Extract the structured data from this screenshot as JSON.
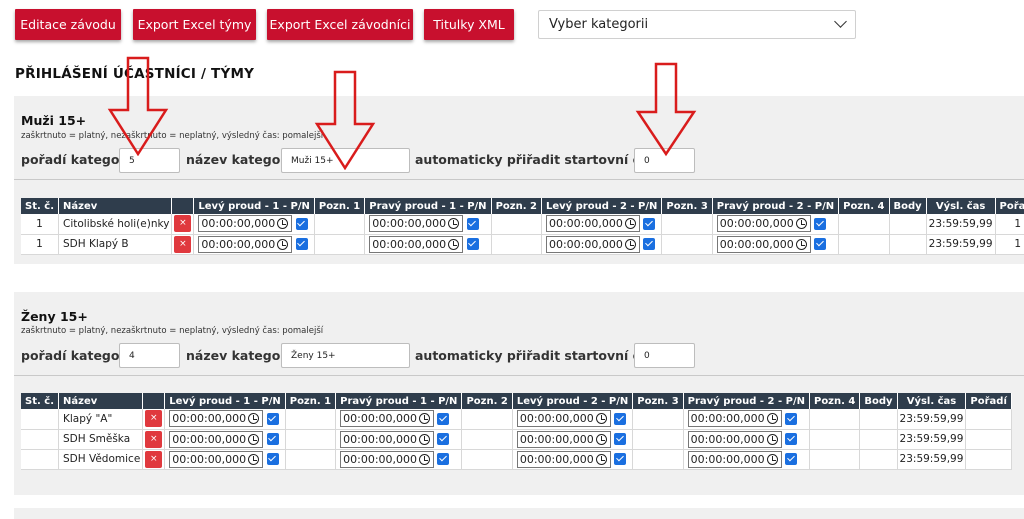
{
  "toolbar": {
    "buttons": [
      "Editace závodu",
      "Export Excel týmy",
      "Export Excel závodníci",
      "Titulky XML"
    ],
    "category_select": "Vyber kategorii"
  },
  "page_title": "PŘIHLÁŠENÍ ÚČASTNÍCI / TÝMY",
  "colors": {
    "button_red": "#c8102e",
    "header_dark": "#2f3d4c",
    "checkbox_blue": "#1a6fe0",
    "remove_red": "#e0393e",
    "arrow_red": "#d91c1c"
  },
  "categories": [
    {
      "title": "Muži 15+",
      "note": "zaškrtnuto = platný, nezaškrtnuto = neplatný, výsledný čas: pomalejší",
      "order_label": "pořadí kategorie:",
      "order_value": "5",
      "name_label": "název kategorie:",
      "name_value": "Muži 15+",
      "auto_label": "automaticky přiřadit startovní čísla od:",
      "auto_value": "0",
      "columns": [
        "St. č.",
        "Název",
        "",
        "Levý proud - 1 - P/N",
        "Pozn. 1",
        "Pravý proud - 1 - P/N",
        "Pozn. 2",
        "Levý proud - 2 - P/N",
        "Pozn. 3",
        "Pravý proud - 2 - P/N",
        "Pozn. 4",
        "Body",
        "Výsl. čas",
        "Pořadí"
      ],
      "rows": [
        {
          "st": "1",
          "name": "Citolibské holi(e)nky",
          "remove": "×",
          "t1": "00:00:00,000",
          "t2": "00:00:00,000",
          "t3": "00:00:00,000",
          "t4": "00:00:00,000",
          "result": "23:59:59,99",
          "rank": "1"
        },
        {
          "st": "1",
          "name": "SDH Klapý B",
          "remove": "×",
          "t1": "00:00:00,000",
          "t2": "00:00:00,000",
          "t3": "00:00:00,000",
          "t4": "00:00:00,000",
          "result": "23:59:59,99",
          "rank": "1"
        }
      ]
    },
    {
      "title": "Ženy 15+",
      "note": "zaškrtnuto = platný, nezaškrtnuto = neplatný, výsledný čas: pomalejší",
      "order_label": "pořadí kategorie:",
      "order_value": "4",
      "name_label": "název kategorie:",
      "name_value": "Ženy 15+",
      "auto_label": "automaticky přiřadit startovní čísla od:",
      "auto_value": "0",
      "columns": [
        "St. č.",
        "Název",
        "",
        "Levý proud - 1 - P/N",
        "Pozn. 1",
        "Pravý proud - 1 - P/N",
        "Pozn. 2",
        "Levý proud - 2 - P/N",
        "Pozn. 3",
        "Pravý proud - 2 - P/N",
        "Pozn. 4",
        "Body",
        "Výsl. čas",
        "Pořadí"
      ],
      "rows": [
        {
          "st": "",
          "name": "Klapý \"A\"",
          "remove": "×",
          "t1": "00:00:00,000",
          "t2": "00:00:00,000",
          "t3": "00:00:00,000",
          "t4": "00:00:00,000",
          "result": "23:59:59,99",
          "rank": ""
        },
        {
          "st": "",
          "name": "SDH Směška",
          "remove": "×",
          "t1": "00:00:00,000",
          "t2": "00:00:00,000",
          "t3": "00:00:00,000",
          "t4": "00:00:00,000",
          "result": "23:59:59,99",
          "rank": ""
        },
        {
          "st": "",
          "name": "SDH Vědomice",
          "remove": "×",
          "t1": "00:00:00,000",
          "t2": "00:00:00,000",
          "t3": "00:00:00,000",
          "t4": "00:00:00,000",
          "result": "23:59:59,99",
          "rank": ""
        }
      ]
    }
  ]
}
